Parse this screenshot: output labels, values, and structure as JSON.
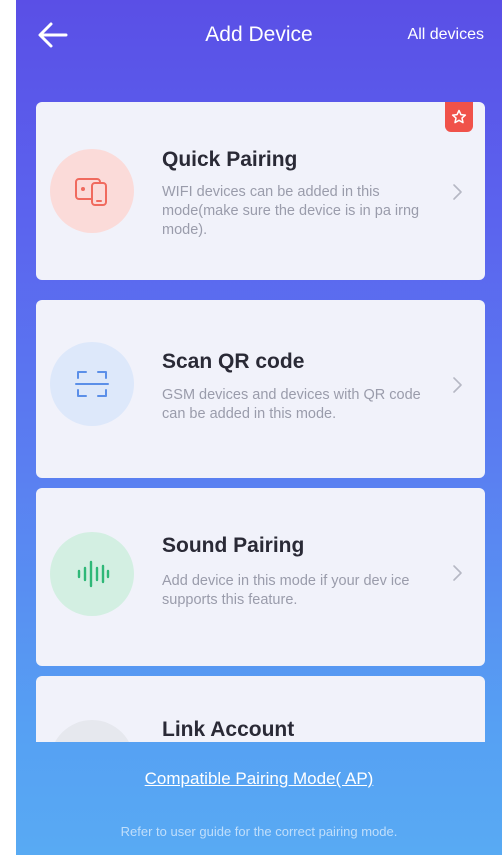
{
  "header": {
    "title": "Add Device",
    "all_devices_label": "All devices",
    "back_icon": "arrow-left-icon"
  },
  "cards": [
    {
      "title": "Quick Pairing",
      "description": "WIFI devices can be added in this mode(make sure the device is in pa irng mode).",
      "icon": "phone-device-icon",
      "icon_color": "#f06a5e",
      "icon_bg": "#fbdbd9",
      "badge_icon": "star-icon"
    },
    {
      "title": "Scan QR code",
      "description": "GSM devices and devices with QR code can be added in this mode.",
      "icon": "scan-frame-icon",
      "icon_color": "#5b8fe8",
      "icon_bg": "#dde8fa"
    },
    {
      "title": "Sound Pairing",
      "description": "Add device in this mode if your dev ice supports this feature.",
      "icon": "sound-wave-icon",
      "icon_color": "#2fb878",
      "icon_bg": "#d3efe2"
    },
    {
      "title": "Link Account",
      "icon": "link-account-icon",
      "icon_color": "#2fb878",
      "icon_bg": "#e6e8ee"
    }
  ],
  "footer": {
    "compatible_mode_link": "Compatible Pairing Mode( AP)",
    "hint": "Refer to user guide for the correct pairing mode."
  },
  "colors": {
    "accent_badge": "#f0524a",
    "card_bg": "#f1f2fa"
  }
}
